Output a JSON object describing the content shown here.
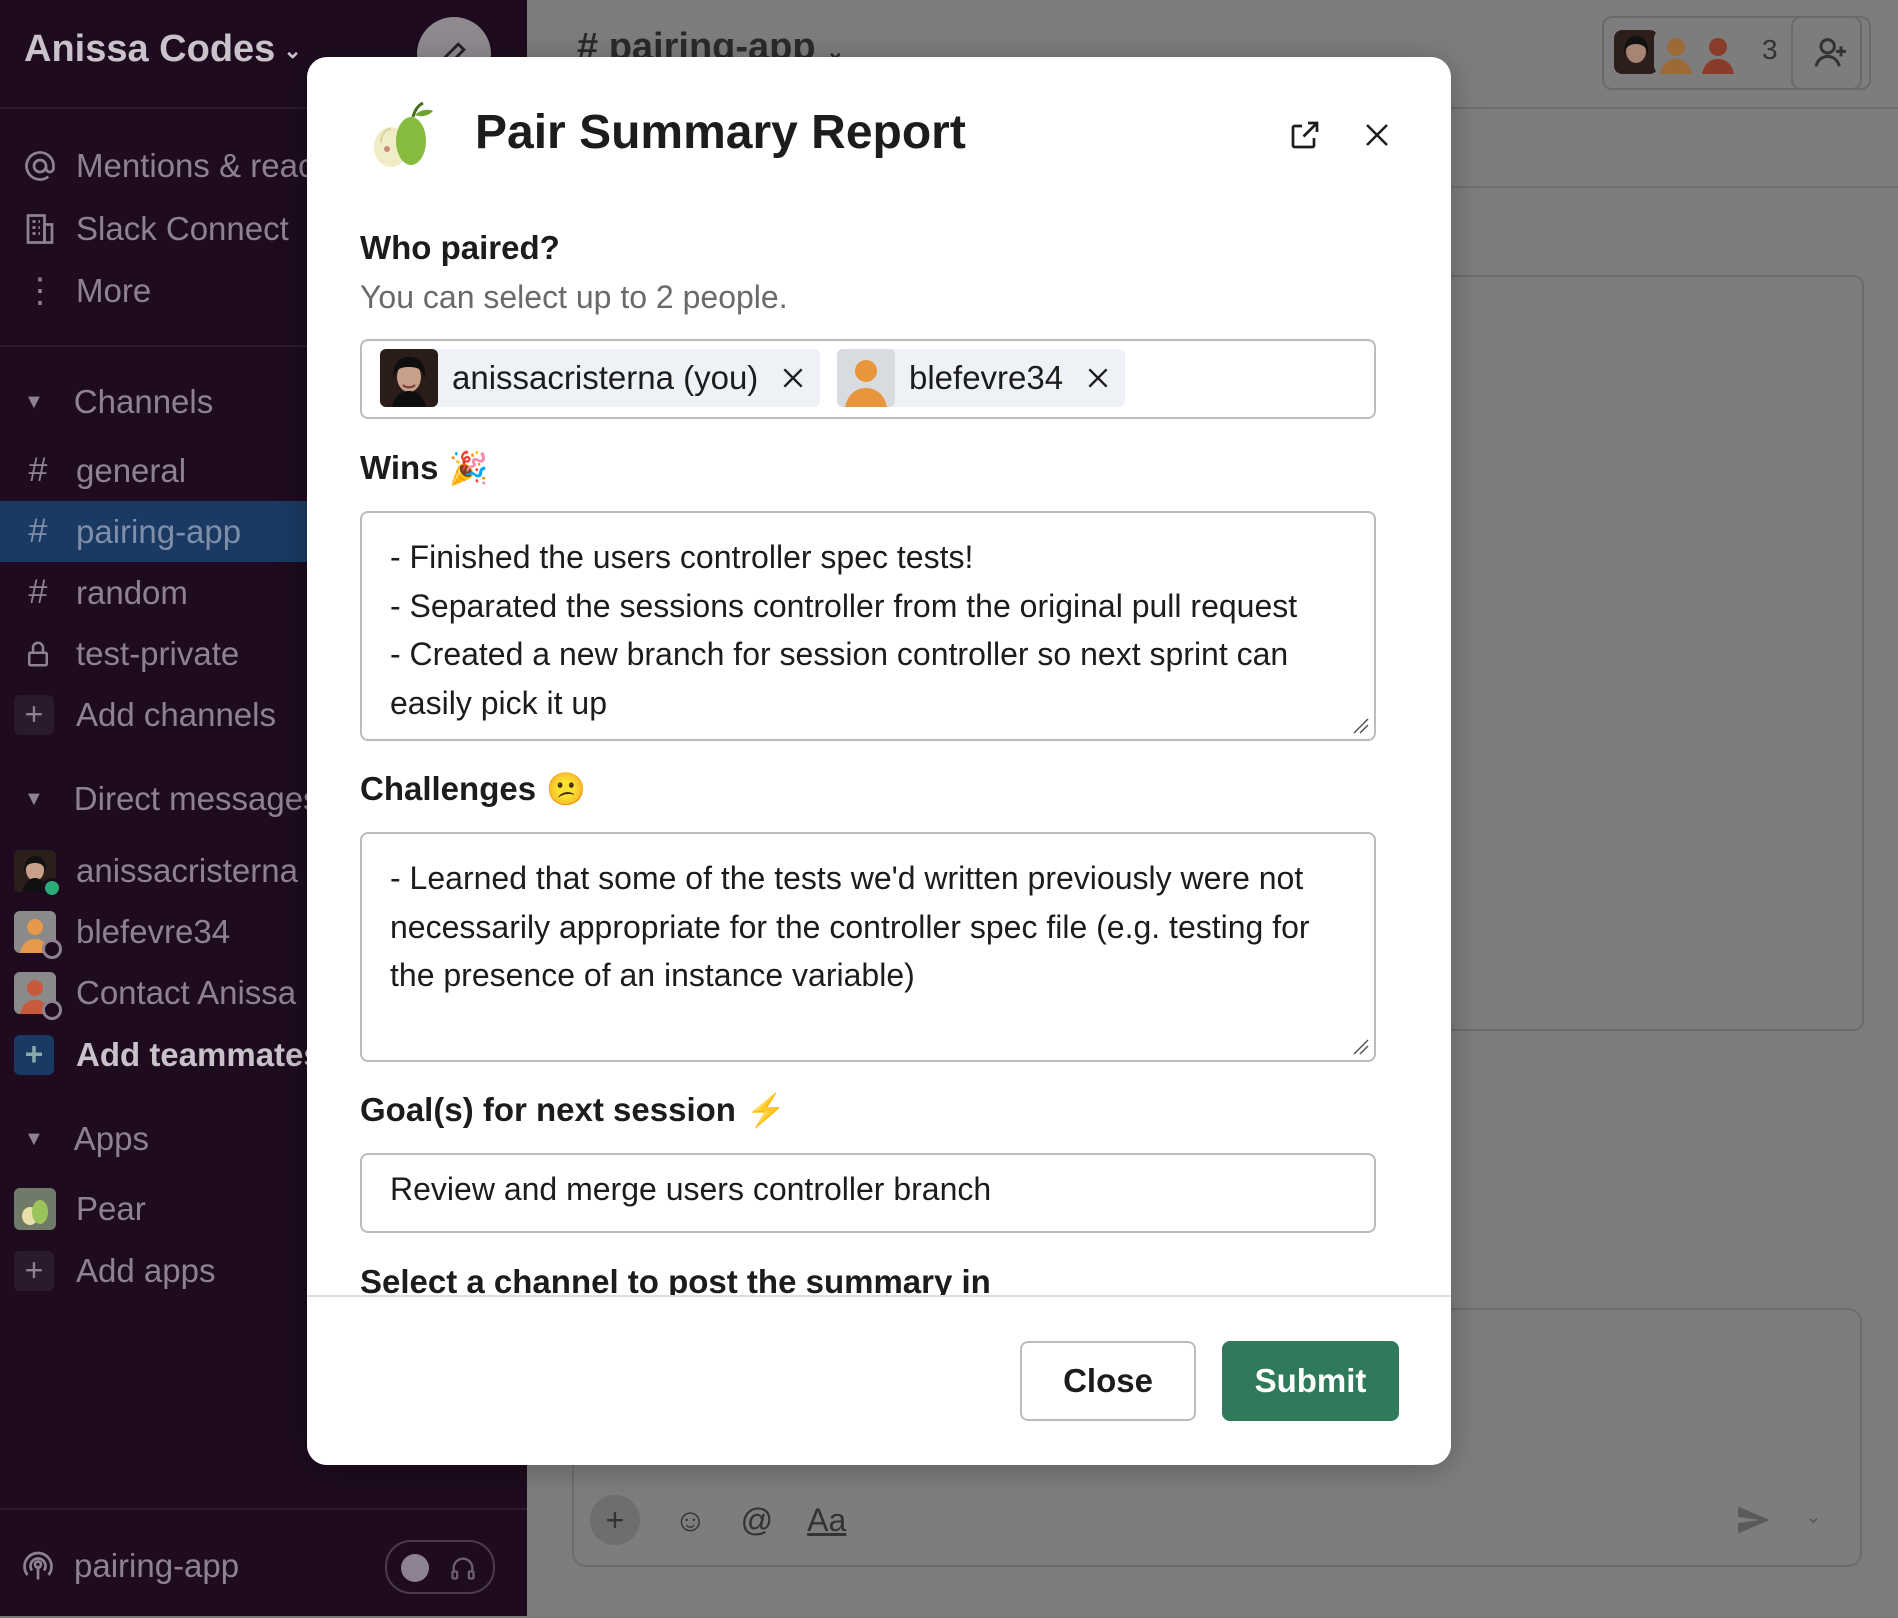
{
  "workspace": {
    "name": "Anissa Codes"
  },
  "sidebar": {
    "nav": [
      {
        "label": "Mentions & reactions"
      },
      {
        "label": "Slack Connect"
      },
      {
        "label": "More"
      }
    ],
    "channels_title": "Channels",
    "channels": [
      {
        "label": "general",
        "icon": "hash"
      },
      {
        "label": "pairing-app",
        "icon": "hash",
        "active": true
      },
      {
        "label": "random",
        "icon": "hash"
      },
      {
        "label": "test-private",
        "icon": "lock"
      }
    ],
    "add_channels": "Add channels",
    "dms_title": "Direct messages",
    "dms": [
      {
        "label": "anissacristerna"
      },
      {
        "label": "blefevre34"
      },
      {
        "label": "Contact Anissa"
      }
    ],
    "add_teammates": "Add teammates",
    "apps_title": "Apps",
    "apps": [
      {
        "label": "Pear"
      }
    ],
    "add_apps": "Add apps",
    "huddle_channel": "pairing-app"
  },
  "main": {
    "channel_title": "# pairing-app",
    "member_count": "3",
    "composer_format_label": "Aa"
  },
  "modal": {
    "title": "Pair Summary Report",
    "who_label": "Who paired?",
    "who_hint": "You can select up to 2 people.",
    "selected_people": [
      {
        "name": "anissacristerna (you)"
      },
      {
        "name": "blefevre34"
      }
    ],
    "wins_label": "Wins",
    "wins_emoji": "🎉",
    "wins_value": "- Finished the users controller spec tests!\n- Separated the sessions controller from the original pull request\n- Created a new branch for session controller so next sprint can easily pick it up",
    "challenges_label": "Challenges",
    "challenges_emoji": "😕",
    "challenges_value": "- Learned that some of the tests we'd written previously were not necessarily appropriate for the controller spec file (e.g. testing for the presence of an instance variable)",
    "goals_label": "Goal(s) for next session",
    "goals_emoji": "⚡",
    "goals_value": "Review and merge users controller branch",
    "channel_select_label": "Select a channel to post the summary in",
    "close_button": "Close",
    "submit_button": "Submit"
  },
  "colors": {
    "sidebar_bg": "#1e0b1f",
    "active_channel_bg": "#1a3a63",
    "submit_green": "#2f7a5b"
  }
}
